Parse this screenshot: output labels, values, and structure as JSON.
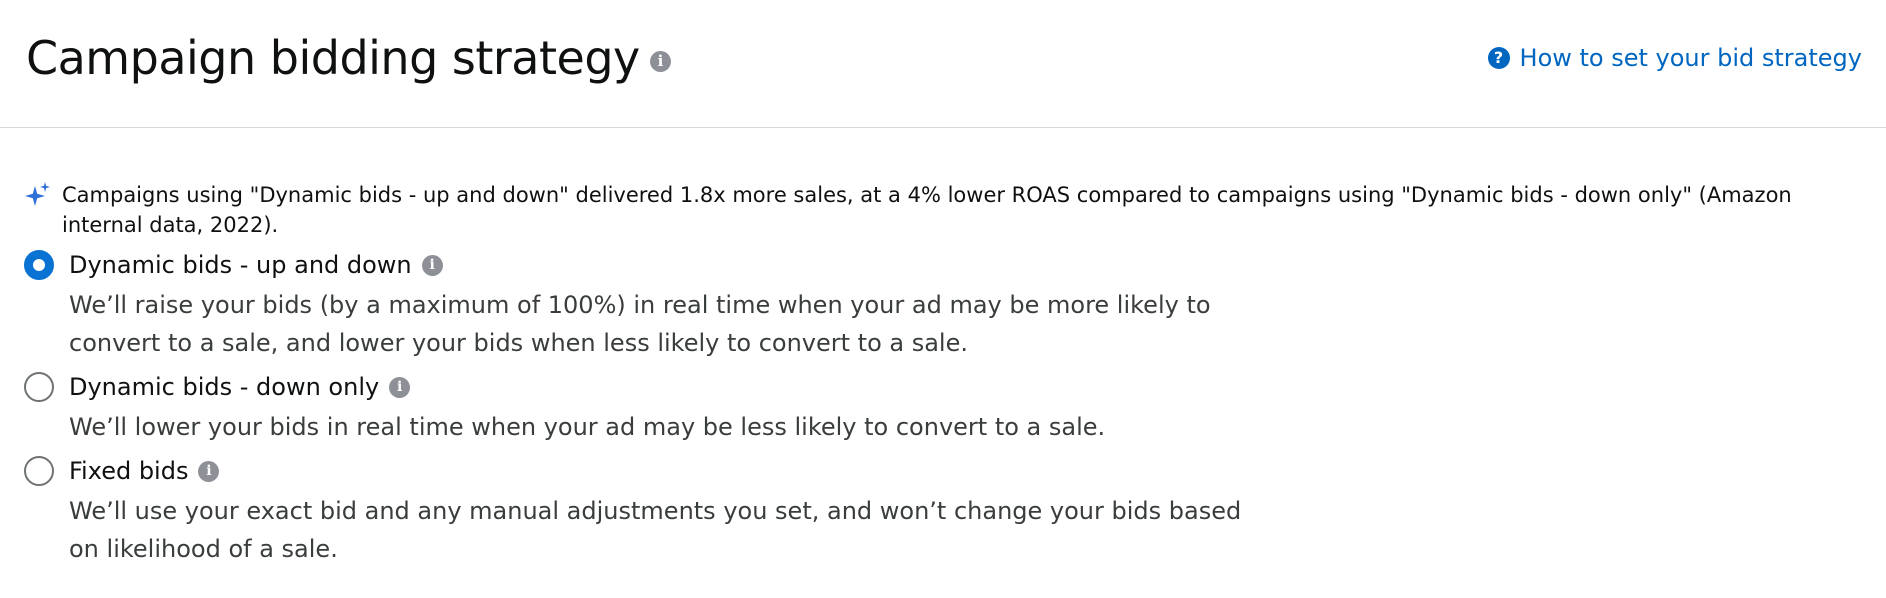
{
  "header": {
    "title": "Campaign bidding strategy",
    "info_icon": "info-icon",
    "help_link_label": "How to set your bid strategy",
    "help_icon": "question-circle-icon"
  },
  "insight": {
    "icon": "sparkle-icon",
    "text": "Campaigns using \"Dynamic bids - up and down\" delivered 1.8x more sales, at a 4% lower ROAS compared to campaigns using \"Dynamic bids - down only\" (Amazon internal data, 2022)."
  },
  "options": [
    {
      "label": "Dynamic bids - up and down",
      "selected": true,
      "description_lines": [
        "We’ll raise your bids (by a maximum of 100%) in real time when your ad may be more likely to",
        "convert to a sale, and lower your bids when less likely to convert to a sale."
      ]
    },
    {
      "label": "Dynamic bids - down only",
      "selected": false,
      "description_lines": [
        "We’ll lower your bids in real time when your ad may be less likely to convert to a sale."
      ]
    },
    {
      "label": "Fixed bids",
      "selected": false,
      "description_lines": [
        "We’ll use your exact bid and any manual adjustments you set, and won’t change your bids based",
        "on likelihood of a sale."
      ]
    }
  ],
  "colors": {
    "link": "#0066c0",
    "radio_selected": "#0972d3",
    "info_icon": "#8d9096",
    "sparkle": "#2f6fd6"
  }
}
